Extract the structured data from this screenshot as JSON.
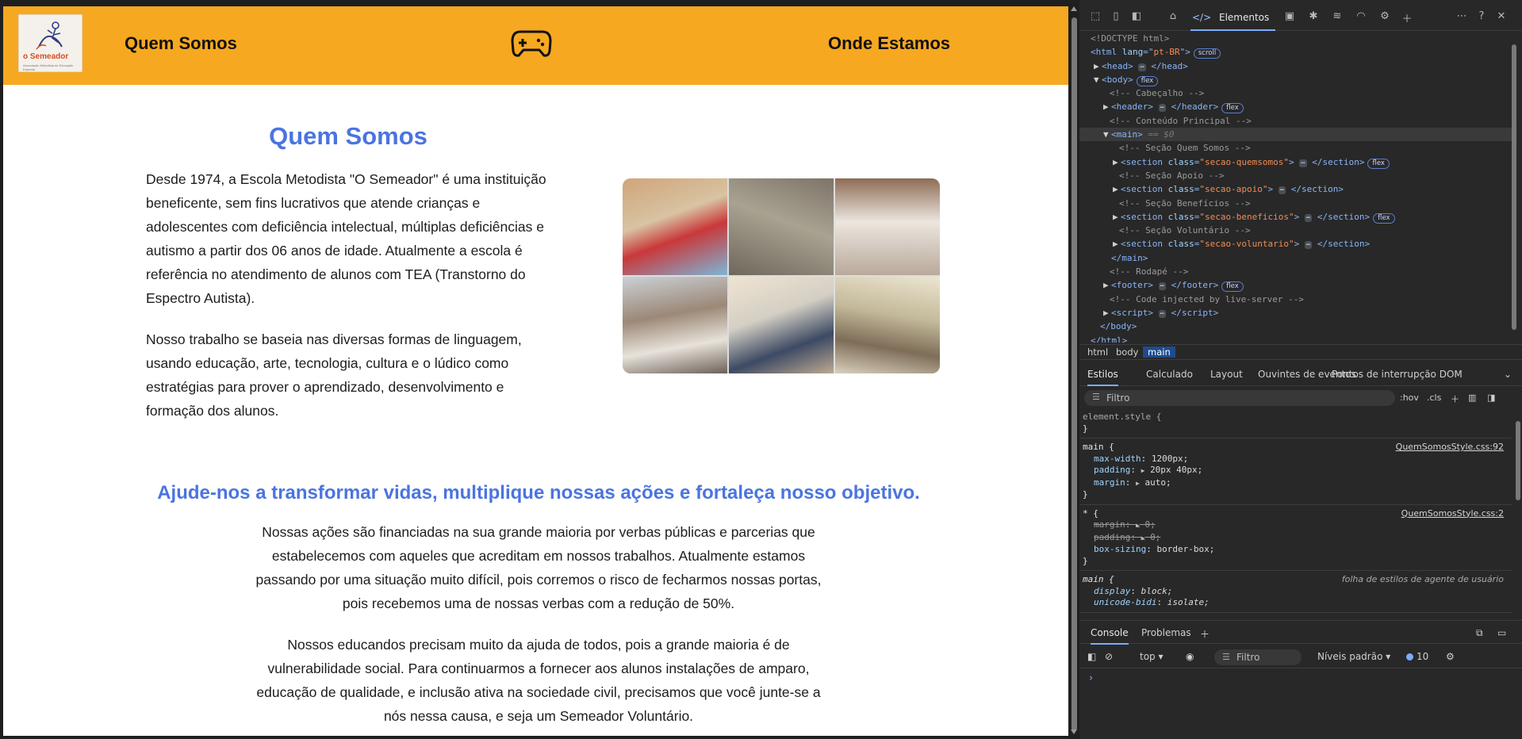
{
  "site": {
    "logo_text": "o Semeador",
    "logo_subtext": "Associação Metodista de Educação Especial",
    "nav_left": "Quem Somos",
    "nav_right": "Onde Estamos",
    "accent_color": "#f6a821",
    "heading_color": "#4a74e0"
  },
  "quem_somos": {
    "title": "Quem Somos",
    "para1": "Desde 1974, a Escola Metodista \"O Semeador\" é uma instituição beneficente, sem fins lucrativos que atende crianças e adolescentes com deficiência intelectual, múltiplas deficiências e autismo a partir dos 06 anos de idade. Atualmente a escola é referência no atendimento de alunos com TEA (Transtorno do Espectro Autista).",
    "para2": "Nosso trabalho se baseia nas diversas formas de linguagem, usando educação, arte, tecnologia, cultura e o lúdico como estratégias para prover o aprendizado, desenvolvimento e formação dos alunos."
  },
  "apoio": {
    "title": "Ajude-nos a transformar vidas, multiplique nossas ações e fortaleça nosso objetivo.",
    "para1": "Nossas ações são financiadas na sua grande maioria por verbas públicas e parcerias que estabelecemos com aqueles que acreditam em nossos trabalhos. Atualmente estamos passando por uma situação muito difícil, pois corremos o risco de fecharmos nossas portas, pois recebemos uma de nossas verbas com a redução de 50%.",
    "para2": "Nossos educandos precisam muito da ajuda de todos, pois a grande maioria é de vulnerabilidade social. Para continuarmos a fornecer aos alunos instalações de amparo, educação de qualidade, e inclusão ativa na sociedade civil, precisamos que você junte-se a nós nessa causa, e seja um Semeador Voluntário."
  },
  "devtools": {
    "elements_tab": "Elementos",
    "dom": {
      "doctype": "<!DOCTYPE html>",
      "html_lang": "pt-BR",
      "scroll_badge": "scroll",
      "flex_badge": "flex",
      "c_cabecalho": "<!-- Cabeçalho -->",
      "c_conteudo": "<!-- Conteúdo Principal -->",
      "main_marker": "== $0",
      "c_quem": "<!-- Seção Quem Somos -->",
      "cls_quem": "\"secao-quemsomos\"",
      "c_apoio": "<!-- Seção Apoio -->",
      "cls_apoio": "\"secao-apoio\"",
      "c_beneficios": "<!-- Seção Benefícios -->",
      "cls_beneficios": "\"secao-beneficios\"",
      "c_voluntario": "<!-- Seção Voluntário -->",
      "cls_voluntario": "\"secao-voluntario\"",
      "c_rodape": "<!-- Rodapé -->",
      "c_injected": "<!-- Code injected by live-server -->"
    },
    "breadcrumbs": [
      "html",
      "body",
      "main"
    ],
    "style_tabs": [
      "Estilos",
      "Calculado",
      "Layout",
      "Ouvintes de eventos",
      "Pontos de interrupção DOM"
    ],
    "filter_placeholder": "Filtro",
    "hov": ":hov",
    "cls": ".cls",
    "rules": {
      "element_style": "element.style {",
      "main_selector": "main {",
      "main_source": "QuemSomosStyle.css:92",
      "max_width": "1200px;",
      "padding": "20px 40px;",
      "margin": "auto;",
      "star_selector": "* {",
      "star_source": "QuemSomosStyle.css:2",
      "star_margin": "0;",
      "star_padding": "0;",
      "box_sizing": "border-box;",
      "ua_selector": "main {",
      "ua_source": "folha de estilos de agente de usuário",
      "display": "block;",
      "unicode_bidi": "isolate;"
    },
    "console_tabs": [
      "Console",
      "Problemas"
    ],
    "console_context": "top",
    "console_filter": "Filtro",
    "console_levels": "Níveis padrão",
    "message_count": "10"
  }
}
